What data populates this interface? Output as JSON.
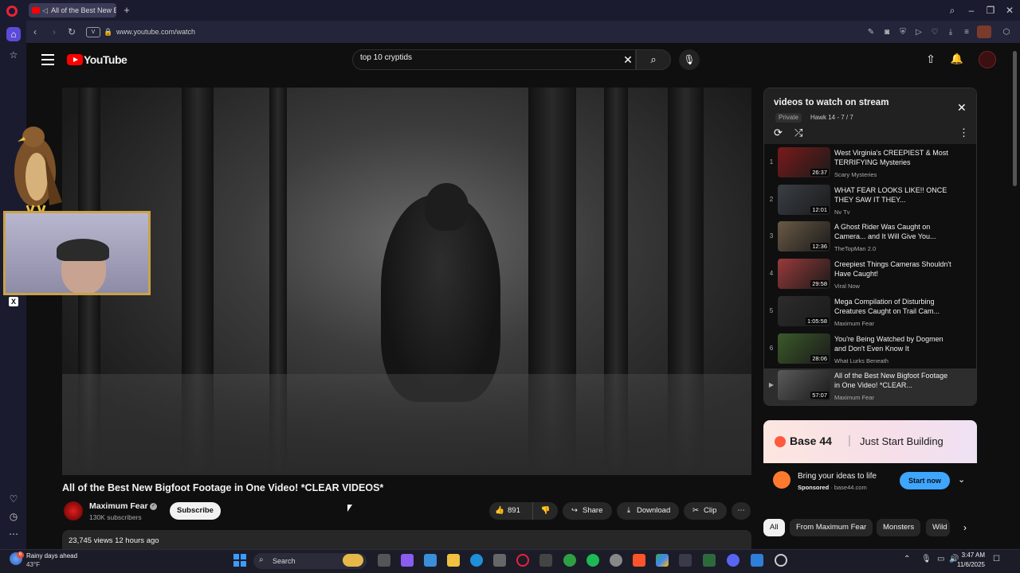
{
  "browser": {
    "tab_title": "All of the Best New Bi",
    "url": "www.youtube.com/watch",
    "vpn_label": "V"
  },
  "youtube": {
    "logo_text": "YouTube",
    "search": {
      "value": "top 10 cryptids"
    }
  },
  "video": {
    "title": "All of the Best New Bigfoot Footage in One Video! *CLEAR VIDEOS*",
    "channel": "Maximum Fear",
    "subscribers": "130K subscribers",
    "subscribe_label": "Subscribe",
    "likes": "891",
    "share_label": "Share",
    "download_label": "Download",
    "clip_label": "Clip",
    "views_line": "23,745 views  12 hours ago"
  },
  "playlist": {
    "title": "videos to watch on stream",
    "privacy": "Private",
    "owner": "Hawk 14 - 7 / 7",
    "items": [
      {
        "index": "1",
        "title": "West Virginia's CREEPIEST & Most TERRIFYING Mysteries",
        "channel": "Scary Mysteries",
        "duration": "26:37",
        "thumb_color": "#7a1a1a"
      },
      {
        "index": "2",
        "title": "WHAT FEAR LOOKS LIKE!! ONCE THEY SAW IT THEY...",
        "channel": "Nv Tv",
        "duration": "12:01",
        "thumb_color": "#3a3f45"
      },
      {
        "index": "3",
        "title": "A Ghost Rider Was Caught on Camera... and It Will Give You...",
        "channel": "TheTopMan 2.0",
        "duration": "12:36",
        "thumb_color": "#6a5a45"
      },
      {
        "index": "4",
        "title": "Creepiest Things Cameras Shouldn't Have Caught!",
        "channel": "Viral Now",
        "duration": "29:58",
        "thumb_color": "#9a3a3a"
      },
      {
        "index": "5",
        "title": "Mega Compilation of Disturbing Creatures Caught on Trail Cam...",
        "channel": "Maximum Fear",
        "duration": "1:05:58",
        "thumb_color": "#2c2c2c"
      },
      {
        "index": "6",
        "title": "You're Being Watched by Dogmen and Don't Even Know It",
        "channel": "What Lurks Beneath",
        "duration": "28:06",
        "thumb_color": "#3b5a2a"
      },
      {
        "index": "▶",
        "title": "All of the Best New Bigfoot Footage in One Video! *CLEAR...",
        "channel": "Maximum Fear",
        "duration": "57:07",
        "thumb_color": "#5a5a5a"
      }
    ]
  },
  "ad": {
    "brand": "Base 44",
    "tagline": "Just Start Building",
    "headline": "Bring your ideas to life",
    "sponsored": "Sponsored",
    "domain": "base44.com",
    "cta": "Start now"
  },
  "chips": [
    "All",
    "From Maximum Fear",
    "Monsters",
    "Wild"
  ],
  "taskbar": {
    "weather_text": "Rainy days ahead",
    "weather_temp": "43°F",
    "weather_badge": "6",
    "search_label": "Search",
    "time": "3:47 AM",
    "date": "11/6/2025"
  },
  "colors": {
    "youtube_red": "#ff0000",
    "accent_blue": "#3ea6ff",
    "webcam_frame": "#c9a24a",
    "opera_red": "#e8233a"
  }
}
